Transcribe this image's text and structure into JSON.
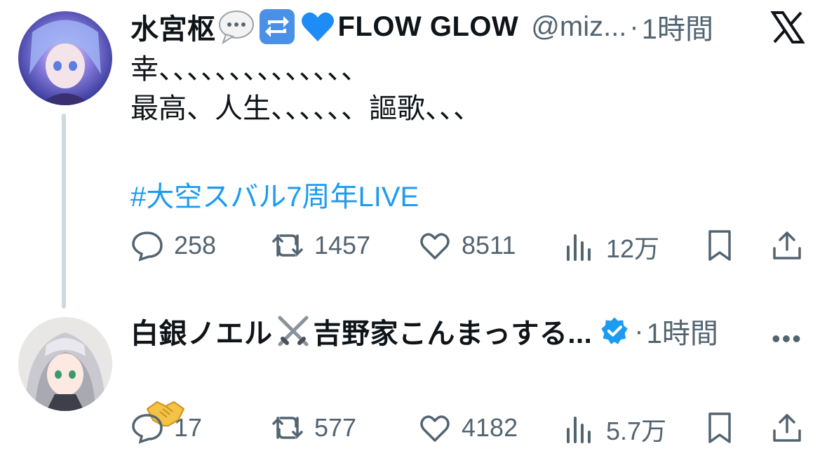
{
  "tweet1": {
    "display_name": "水宮枢",
    "display_name_tail": "FLOW GLOW",
    "handle": "@miz...",
    "separator": "·",
    "time": "1時間",
    "body_line1": "幸、、、、、、、、、、、、、、",
    "body_line2": "最高、人生、、、、、、謳歌、、、",
    "hashtag": "#大空スバル7周年LIVE",
    "replies": "258",
    "retweets": "1457",
    "likes": "8511",
    "views": "12万"
  },
  "tweet2": {
    "display_name": "白銀ノエル",
    "display_name_tail": "吉野家こんまっする...",
    "separator": "·",
    "time": "1時間",
    "body_emoji": "🤝",
    "replies": "17",
    "retweets": "577",
    "likes": "4182",
    "views": "5.7万"
  },
  "icons": {
    "x_logo": "x-logo-icon",
    "reply": "reply-icon",
    "retweet": "retweet-icon",
    "like": "heart-icon",
    "views": "views-chart-icon",
    "bookmark": "bookmark-icon",
    "share": "share-icon",
    "verified": "verified-badge-icon",
    "more": "more-options-icon"
  },
  "colors": {
    "text": "#0f1419",
    "muted": "#536471",
    "link": "#1d9bf0",
    "verified": "#1d9bf0",
    "thread_line": "#cfd9de",
    "heart_emoji_blue": "#1d8cf5"
  }
}
